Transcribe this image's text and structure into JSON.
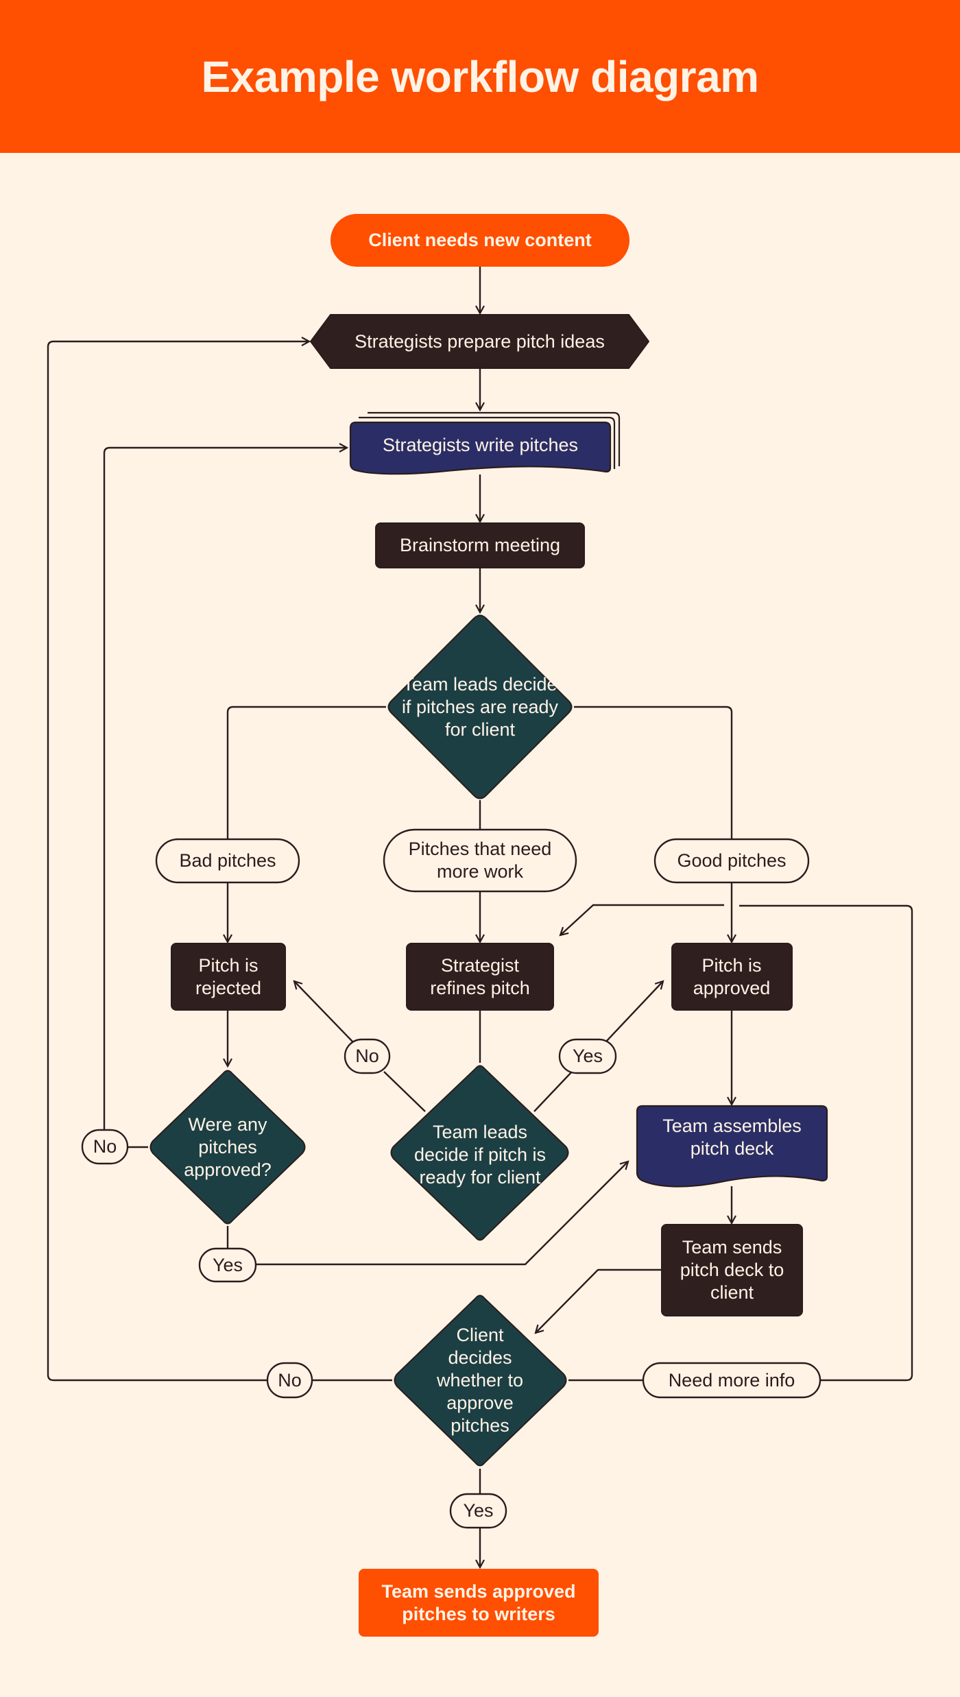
{
  "header": {
    "title": "Example workflow diagram"
  },
  "colors": {
    "brand_orange": "#FF4F00",
    "background": "#FFF3E6",
    "process_dark": "#301F1F",
    "decision_teal": "#1C3F44",
    "document_navy": "#2B2E66",
    "line": "#2A1C1C"
  },
  "nodes": {
    "start": {
      "label": "Client needs new content",
      "shape": "terminator"
    },
    "prepare": {
      "label": "Strategists prepare pitch ideas",
      "shape": "preparation"
    },
    "write": {
      "label": "Strategists write pitches",
      "shape": "multi-document"
    },
    "brainstorm": {
      "label": "Brainstorm meeting",
      "shape": "process"
    },
    "decision1": {
      "label": "Team leads decide if pitches are ready for client",
      "shape": "decision"
    },
    "rejected": {
      "label": "Pitch is rejected",
      "shape": "process"
    },
    "refines": {
      "label": "Strategist refines pitch",
      "shape": "process"
    },
    "approved": {
      "label": "Pitch is approved",
      "shape": "process"
    },
    "were_any": {
      "label": "Were any pitches approved?",
      "shape": "decision"
    },
    "decision2": {
      "label": "Team leads decide if pitch is ready for client",
      "shape": "decision"
    },
    "assembles": {
      "label": "Team assembles pitch deck",
      "shape": "document"
    },
    "sends_deck": {
      "label": "Team sends pitch deck to client",
      "shape": "process"
    },
    "client_decides": {
      "label": "Client decides whether to approve pitches",
      "shape": "decision"
    },
    "end": {
      "label": "Team sends approved pitches to writers",
      "shape": "terminator"
    }
  },
  "edge_labels": {
    "bad": "Bad pitches",
    "more_work": "Pitches that need more work",
    "good": "Good pitches",
    "d2_no": "No",
    "d2_yes": "Yes",
    "were_no": "No",
    "were_yes": "Yes",
    "client_no": "No",
    "client_more_info": "Need more info",
    "client_yes": "Yes"
  }
}
